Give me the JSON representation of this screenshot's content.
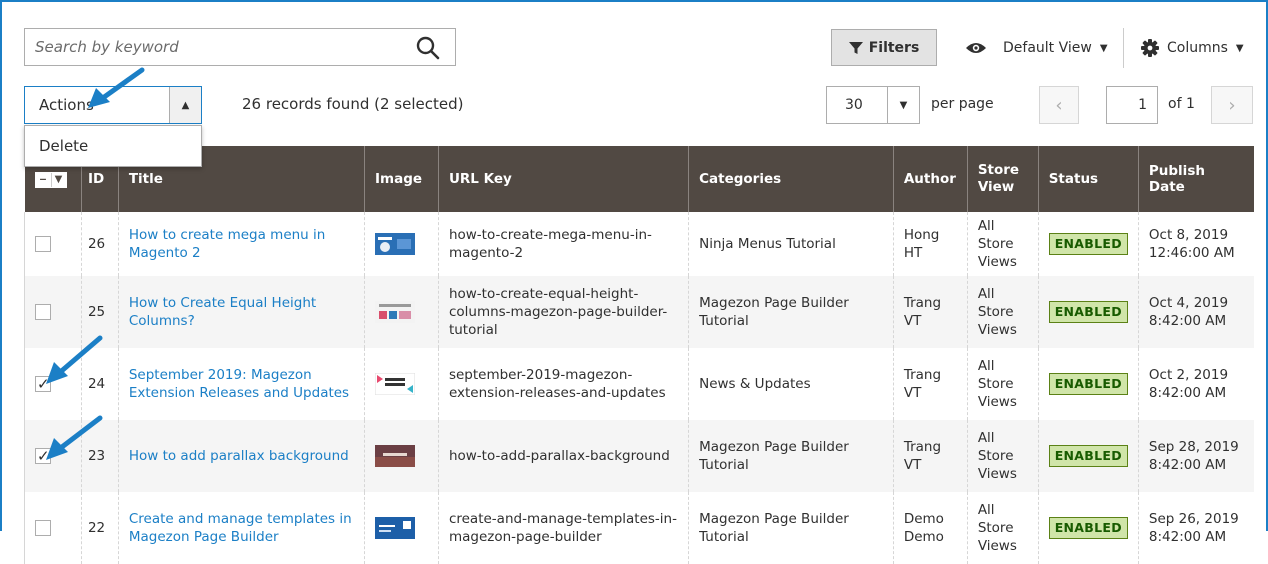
{
  "search": {
    "placeholder": "Search by keyword"
  },
  "toolbar": {
    "filters_label": "Filters",
    "view_label": "Default View",
    "columns_label": "Columns"
  },
  "actions": {
    "label": "Actions",
    "menu_items": [
      "Delete"
    ]
  },
  "records_text": "26 records found (2 selected)",
  "pagination": {
    "per_page_value": "30",
    "per_page_label": "per page",
    "current_page": "1",
    "of_label": "of 1"
  },
  "columns": [
    "ID",
    "Title",
    "Image",
    "URL Key",
    "Categories",
    "Author",
    "Store View",
    "Status",
    "Publish Date"
  ],
  "rows": [
    {
      "checked": false,
      "id": "26",
      "title": "How to create mega menu in Magento 2",
      "url_key": "how-to-create-mega-menu-in-magento-2",
      "categories": "Ninja Menus Tutorial",
      "author": "Hong HT",
      "store_view": "All Store Views",
      "status": "ENABLED",
      "publish_date": "Oct 8, 2019 12:46:00 AM"
    },
    {
      "checked": false,
      "id": "25",
      "title": "How to Create Equal Height Columns?",
      "url_key": "how-to-create-equal-height-columns-magezon-page-builder-tutorial",
      "categories": "Magezon Page Builder Tutorial",
      "author": "Trang VT",
      "store_view": "All Store Views",
      "status": "ENABLED",
      "publish_date": "Oct 4, 2019 8:42:00 AM"
    },
    {
      "checked": true,
      "id": "24",
      "title": "September 2019: Magezon Extension Releases and Updates",
      "url_key": "september-2019-magezon-extension-releases-and-updates",
      "categories": "News & Updates",
      "author": "Trang VT",
      "store_view": "All Store Views",
      "status": "ENABLED",
      "publish_date": "Oct 2, 2019 8:42:00 AM"
    },
    {
      "checked": true,
      "id": "23",
      "title": "How to add parallax background",
      "url_key": "how-to-add-parallax-background",
      "categories": "Magezon Page Builder Tutorial",
      "author": "Trang VT",
      "store_view": "All Store Views",
      "status": "ENABLED",
      "publish_date": "Sep 28, 2019 8:42:00 AM"
    },
    {
      "checked": false,
      "id": "22",
      "title": "Create and manage templates in Magezon Page Builder",
      "url_key": "create-and-manage-templates-in-magezon-page-builder",
      "categories": "Magezon Page Builder Tutorial",
      "author": "Demo Demo",
      "store_view": "All Store Views",
      "status": "ENABLED",
      "publish_date": "Sep 26, 2019 8:42:00 AM"
    }
  ],
  "colors": {
    "header_bg": "#514943",
    "link": "#1b7fc6",
    "status_bg": "#d0e5a9",
    "status_text": "#185b00",
    "annotation_arrow": "#1b7fc6"
  }
}
